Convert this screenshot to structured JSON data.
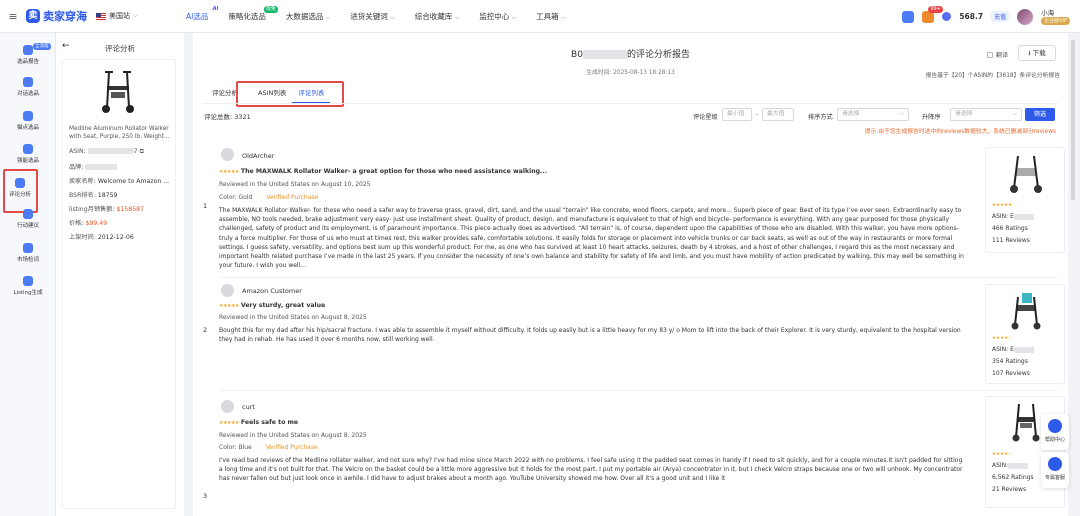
{
  "topbar": {
    "logo_mark": "卖",
    "logo_text": "卖家穿海",
    "region": "美国站",
    "nav": [
      {
        "label": "AI选品",
        "sup": "AI",
        "sup_type": "ai",
        "active": true
      },
      {
        "label": "策略化选品",
        "sup": "限免",
        "sup_type": "free",
        "active": false
      },
      {
        "label": "大数据选品",
        "chevron": true
      },
      {
        "label": "进货关键词",
        "chevron": true
      },
      {
        "label": "综合收藏库",
        "chevron": true
      },
      {
        "label": "监控中心",
        "chevron": true
      },
      {
        "label": "工具箱",
        "chevron": true
      }
    ],
    "badge": "99+",
    "balance": "568.7",
    "recharge": "充值",
    "user_name": "小海",
    "vip": "企业版VIP"
  },
  "leftnav": [
    {
      "label": "选品报告",
      "tag": "全流程",
      "icon": "report-icon"
    },
    {
      "label": "对话选品",
      "icon": "chat-icon"
    },
    {
      "label": "猫点选品",
      "icon": "cat-icon"
    },
    {
      "label": "强能选品",
      "icon": "person-icon"
    },
    {
      "label": "评论分析",
      "icon": "review-analysis-icon",
      "active": true
    },
    {
      "label": "行动建议",
      "icon": "action-icon"
    },
    {
      "label": "市场检词",
      "icon": "market-icon"
    },
    {
      "label": "Listing生成",
      "icon": "listing-icon"
    }
  ],
  "panel": {
    "title": "评论分析",
    "product_name": "Medline Aluminum Rollator Walker with Seat, Purple, 250 lb. Weight...",
    "asin_label": "ASIN:",
    "asin_suffix": "7",
    "brand_label": "品牌:",
    "seller_label": "卖家名称:",
    "seller_value": "Welcome to Amazon ...",
    "bsr_label": "BSR排名:",
    "bsr_value": "18759",
    "monthly_label": "listing月销售额:",
    "monthly_value": "$158587",
    "price_label": "价格:",
    "price_value": "$99.49",
    "listed_label": "上架时间:",
    "listed_value": "2012-12-06"
  },
  "main": {
    "title_prefix": "B0",
    "title_suffix": "的评论分析报告",
    "generated_time": "生成时间: 2025-08-13 18:28:13",
    "translate": "翻译",
    "download": "下载",
    "note": "报告基于【20】个ASIN的【3618】条评论分析报告",
    "tabs": [
      "评论分析",
      "ASIN列表",
      "评论列表"
    ],
    "active_tab": 2,
    "total_label": "评论总数: 3321",
    "filters": {
      "rating_label": "评论星级",
      "min_placeholder": "最小值",
      "max_placeholder": "最大值",
      "sort_label": "排序方式",
      "sort_placeholder": "请选择",
      "order_label": "升降序",
      "order_placeholder": "请选择",
      "button": "筛选"
    },
    "hint": "提示:由于您生成报告时选中的reviews数据较大，系统已删减部分reviews"
  },
  "reviews": [
    {
      "index": "1",
      "author": "OldArcher",
      "stars": "★★★★★",
      "title": "The MAXWALK Rollator Walker- a great option for those who need assistance walking...",
      "meta": "Reviewed in the United States on August 10, 2025",
      "color": "Color: Gold",
      "verified": "Verified Purchase",
      "body": "The MAXWALK Rollator Walker- for those who need a safer way to traverse grass, gravel, dirt, sand, and the usual “terrain” like concrete, wood floors, carpets, and more... Superb piece of gear. Best of its type I’ve ever seen. Extraordinarily easy to assemble, NO tools needed, brake adjustment very easy- just use installment sheet. Quality of product, design, and manufacture is equivalent to that of high end bicycle- performance is everything. With any gear purposed for those physically challenged, safety of product and its employment, is of paramount importance. This piece actually does as advertised. “All terrain” is, of course, dependent upon the capabilities of those who are disabled. With this walker, you have more options- truly a force multiplier. For those of us who must at times rest, this walker provides safe, comfortable solutions. It easily folds for storage or placement into vehicle trunks or car back seats, as well as out of the way in restaurants or more formal settings. I guess safety, versatility, and options best sum up this wonderful product. For me, as one who has survived at least 10 heart attacks, seizures, death by 4 strokes, and a host of other challenges, I regard this as the most necessary and important health related purchase I’ve made in the last 25 years. If you consider the necessity of one’s own balance and stability for safety of life and limb, and you must have mobility of action predicated by walking, this may well be something in your future. I wish you well...",
      "product": {
        "stars": "★★★★★",
        "asin_label": "ASIN: E",
        "ratings": "466 Ratings",
        "reviews": "111 Reviews"
      }
    },
    {
      "index": "2",
      "author": "Amazon Customer",
      "stars": "★★★★★",
      "title": "Very sturdy, great value",
      "meta": "Reviewed in the United States on August 8, 2025",
      "color": "",
      "verified": "",
      "body": "Bought this for my dad after his hip/sacral fracture. I was able to assemble it myself without difficulty. It folds up easily but is a little heavy for my 83 y/ o Mom to lift into the back of their Explorer. It is very sturdy, equivalent to the hospital version they had in rehab. He has used it over 6 months now, still working well.",
      "product": {
        "stars": "★★★★☆",
        "asin_label": "ASIN: E",
        "ratings": "354 Ratings",
        "reviews": "107 Reviews"
      }
    },
    {
      "index": "3",
      "author": "curt",
      "stars": "★★★★★",
      "title": "Feels safe to me",
      "meta": "Reviewed in the United States on August 8, 2025",
      "color": "Color: Blue",
      "verified": "Verified Purchase",
      "body": "I've read bad reviews of the Medline rollater walker, and not sure why? I've had mine since March 2022 with no problems. I feel safe using it the padded seat comes in handy if I need to sit quickly, and for a couple minutes.It isn't padded for sitting a long time and it's not built for that. The Velcro on the basket could be a little more aggressive but it holds for the most part. I put my portable air (Arya) concentrator in it, but I check Velcro straps because one or two will unhook. My concentrator has never fallen out but just look once in awhile. I did have to adjust brakes about a month ago. YouTube University showed me how. Over all it's a good unit and I like it",
      "product": {
        "stars": "★★★★☆",
        "asin_label": "ASIN:",
        "ratings": "6,562 Ratings",
        "reviews": "21 Reviews"
      }
    }
  ],
  "float": {
    "help": "帮助中心",
    "service": "专属客服"
  }
}
